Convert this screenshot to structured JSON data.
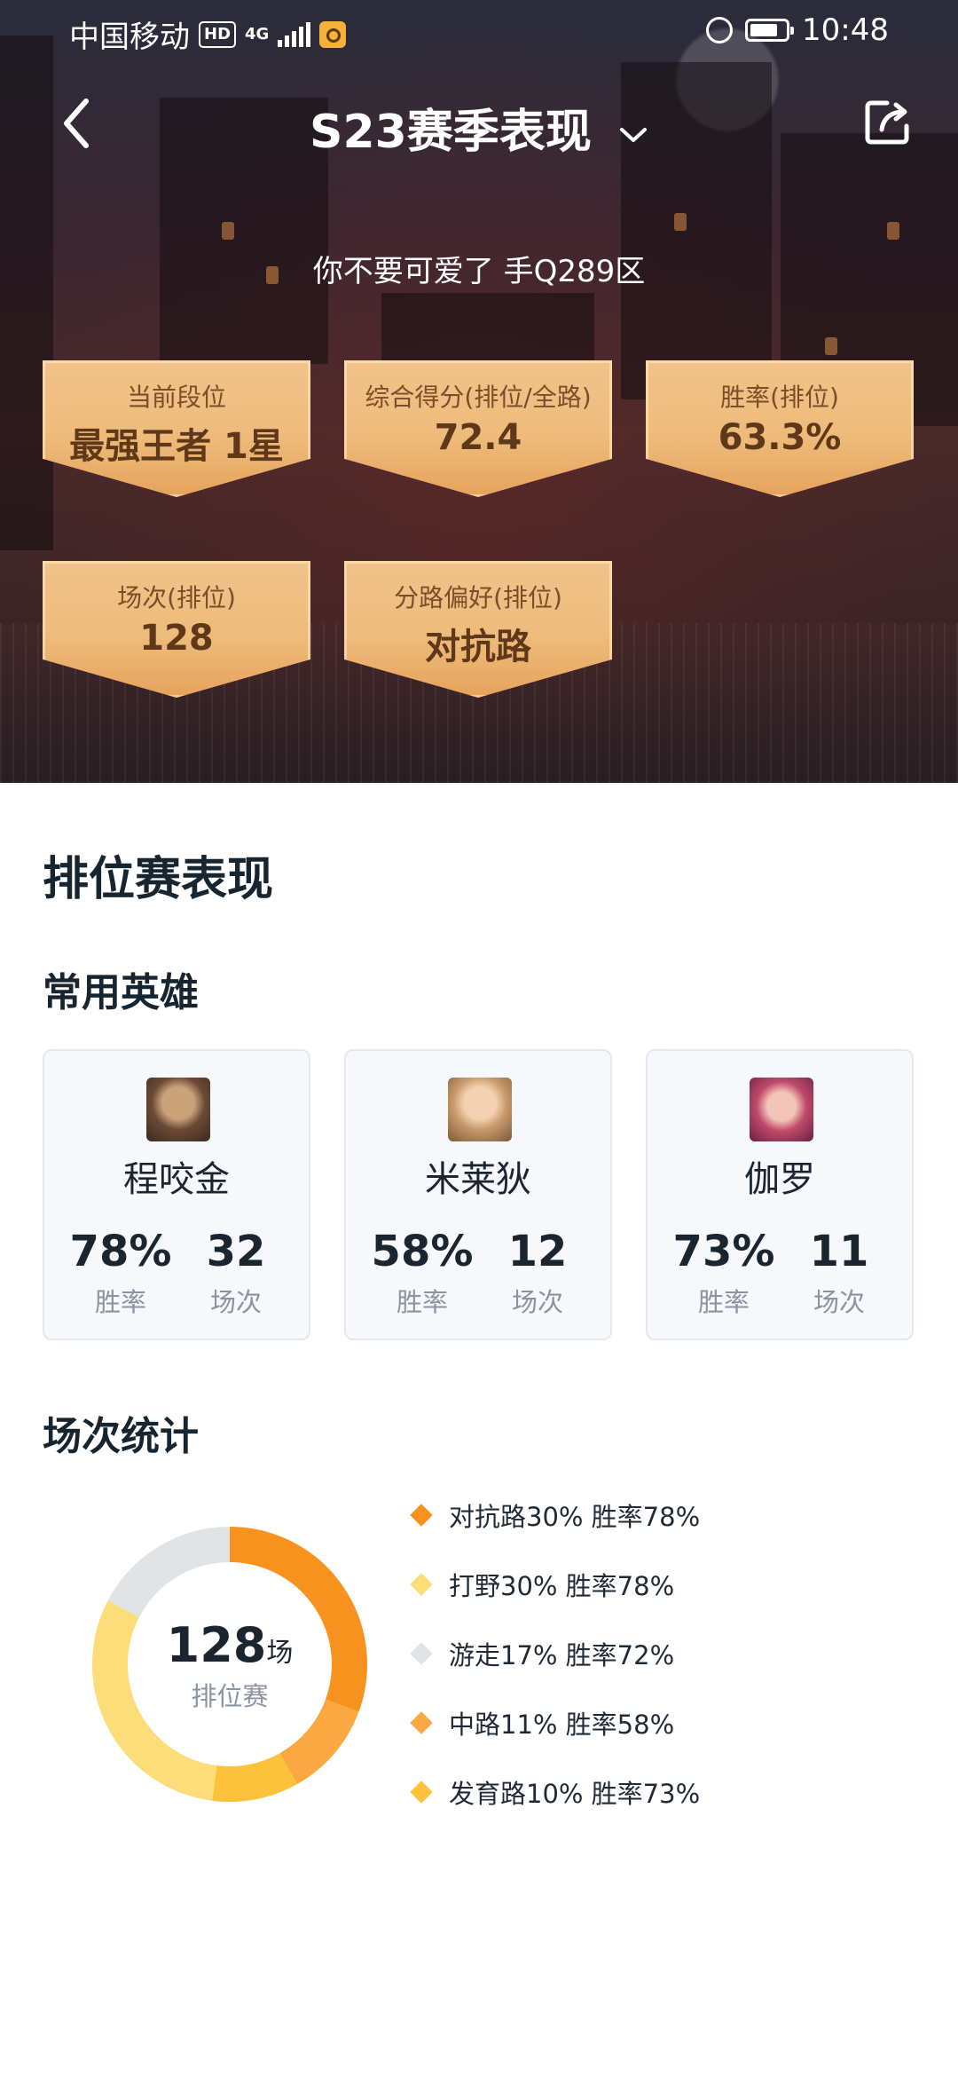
{
  "status": {
    "carrier": "中国移动",
    "hd": "HD",
    "network": "4G",
    "time": "10:48"
  },
  "header": {
    "title": "S23赛季表现",
    "player": "你不要可爱了 手Q289区"
  },
  "stats": [
    {
      "label": "当前段位",
      "value": "最强王者 1星"
    },
    {
      "label": "综合得分(排位/全路)",
      "value": "72.4"
    },
    {
      "label": "胜率(排位)",
      "value": "63.3%"
    },
    {
      "label": "场次(排位)",
      "value": "128"
    },
    {
      "label": "分路偏好(排位)",
      "value": "对抗路"
    }
  ],
  "ranked": {
    "section_title": "排位赛表现",
    "heroes_title": "常用英雄",
    "winrate_caption": "胜率",
    "games_caption": "场次",
    "heroes": [
      {
        "name": "程咬金",
        "winrate": "78%",
        "games": "32",
        "avatar_color": "#6b4a35"
      },
      {
        "name": "米莱狄",
        "winrate": "58%",
        "games": "12",
        "avatar_color": "#c99a6a"
      },
      {
        "name": "伽罗",
        "winrate": "73%",
        "games": "11",
        "avatar_color": "#c04a6a"
      }
    ],
    "games_title": "场次统计",
    "total_games": "128",
    "total_unit": "场",
    "total_caption": "排位赛",
    "lanes": [
      {
        "text": "对抗路30% 胜率78%",
        "share": 30,
        "color": "#f7921e"
      },
      {
        "text": "打野30% 胜率78%",
        "share": 30,
        "color": "#fddc7a"
      },
      {
        "text": "游走17% 胜率72%",
        "share": 17,
        "color": "#e1e4e6"
      },
      {
        "text": "中路11% 胜率58%",
        "share": 11,
        "color": "#fba742"
      },
      {
        "text": "发育路10% 胜率73%",
        "share": 10,
        "color": "#fdc23c"
      }
    ]
  }
}
